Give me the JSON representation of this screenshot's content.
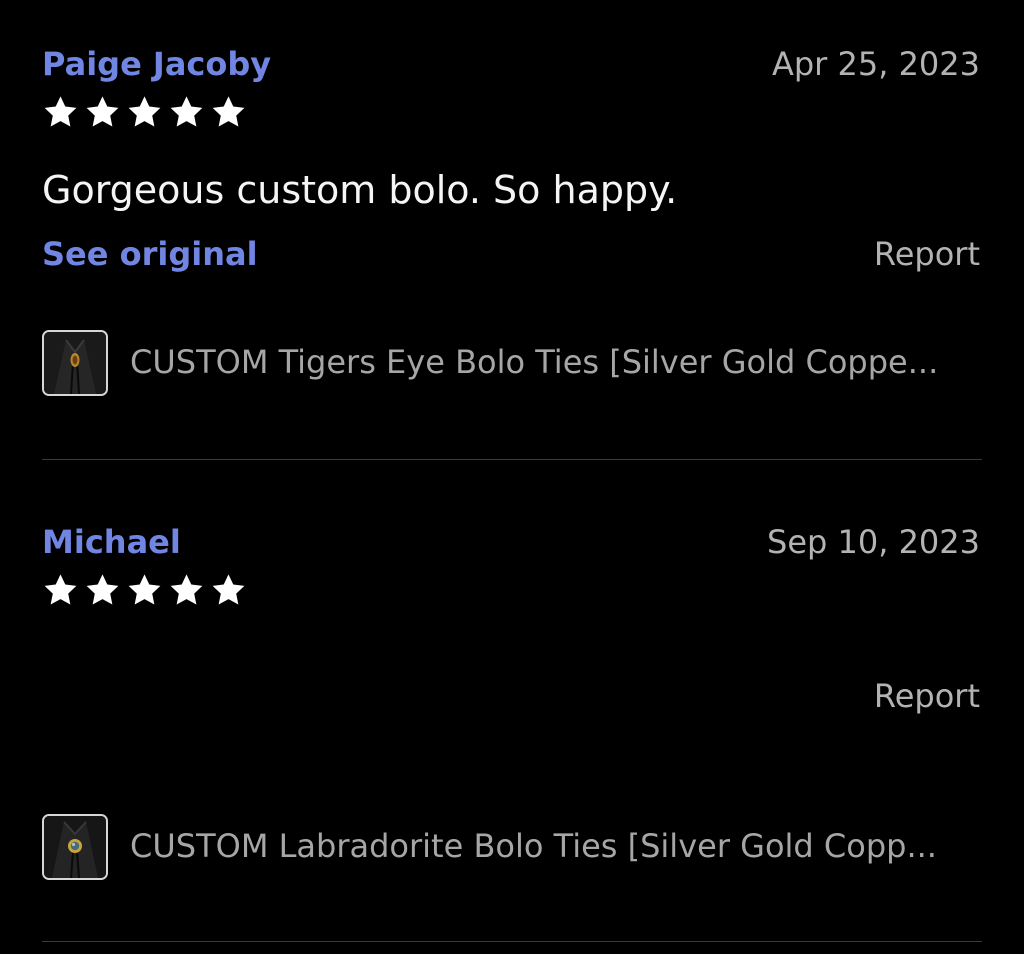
{
  "reviews": [
    {
      "reviewer": "Paige Jacoby",
      "date": "Apr 25, 2023",
      "rating": 5,
      "text": "Gorgeous custom bolo. So happy.",
      "see_original_label": "See original",
      "report_label": "Report",
      "product": {
        "title": "CUSTOM Tigers Eye Bolo Ties [Silver Gold Coppe...",
        "thumbnail_icon": "bolo-tie-tigers-eye-thumbnail"
      }
    },
    {
      "reviewer": "Michael",
      "date": "Sep 10, 2023",
      "rating": 5,
      "text": "",
      "report_label": "Report",
      "product": {
        "title": "CUSTOM Labradorite Bolo Ties [Silver Gold Copp...",
        "thumbnail_icon": "bolo-tie-labradorite-thumbnail"
      }
    }
  ],
  "colors": {
    "background": "#000000",
    "link_accent": "#7186e3",
    "secondary_text": "#b3b3b3",
    "product_text": "#a6a6a6",
    "star": "#ffffff",
    "divider": "#3a3a3a"
  }
}
